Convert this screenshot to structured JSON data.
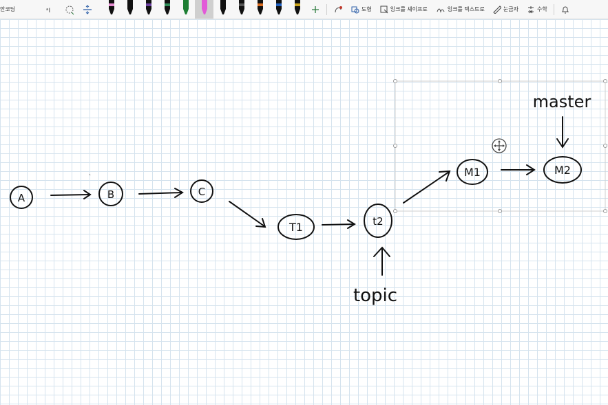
{
  "toolbar": {
    "left_label": "안코딩",
    "shape_label": "도형",
    "ink_to_shape_label": "잉크를 셰이프로",
    "ink_to_text_label": "잉크를 텍스트로",
    "ruler_label": "눈금자",
    "math_label": "수학",
    "pens": [
      {
        "color": "#e58ad0",
        "cap": "#111111"
      },
      {
        "color": "#111111",
        "cap": "#111111"
      },
      {
        "color": "#6b3fa0",
        "cap": "#111111"
      },
      {
        "color": "#2e8b57",
        "cap": "#111111"
      },
      {
        "color": "#1e7f34",
        "cap": "#1e7f34"
      },
      {
        "color": "#e25ad8",
        "cap": "#e25ad8"
      },
      {
        "color": "#111111",
        "cap": "#111111"
      },
      {
        "color": "#555555",
        "cap": "#111111"
      },
      {
        "color": "#d86a1f",
        "cap": "#111111"
      },
      {
        "color": "#1f5fbf",
        "cap": "#111111"
      },
      {
        "color": "#c8a21a",
        "cap": "#111111"
      }
    ]
  },
  "drawing": {
    "nodes": [
      "A",
      "B",
      "C",
      "T1",
      "t2",
      "M1",
      "M2"
    ],
    "labels": {
      "topic": "topic",
      "master": "master"
    }
  },
  "colors": {
    "ink": "#111111",
    "grid": "#d5e3ee",
    "toolbar_bg": "#f7f7f7",
    "selection": "#bdbdbd"
  }
}
